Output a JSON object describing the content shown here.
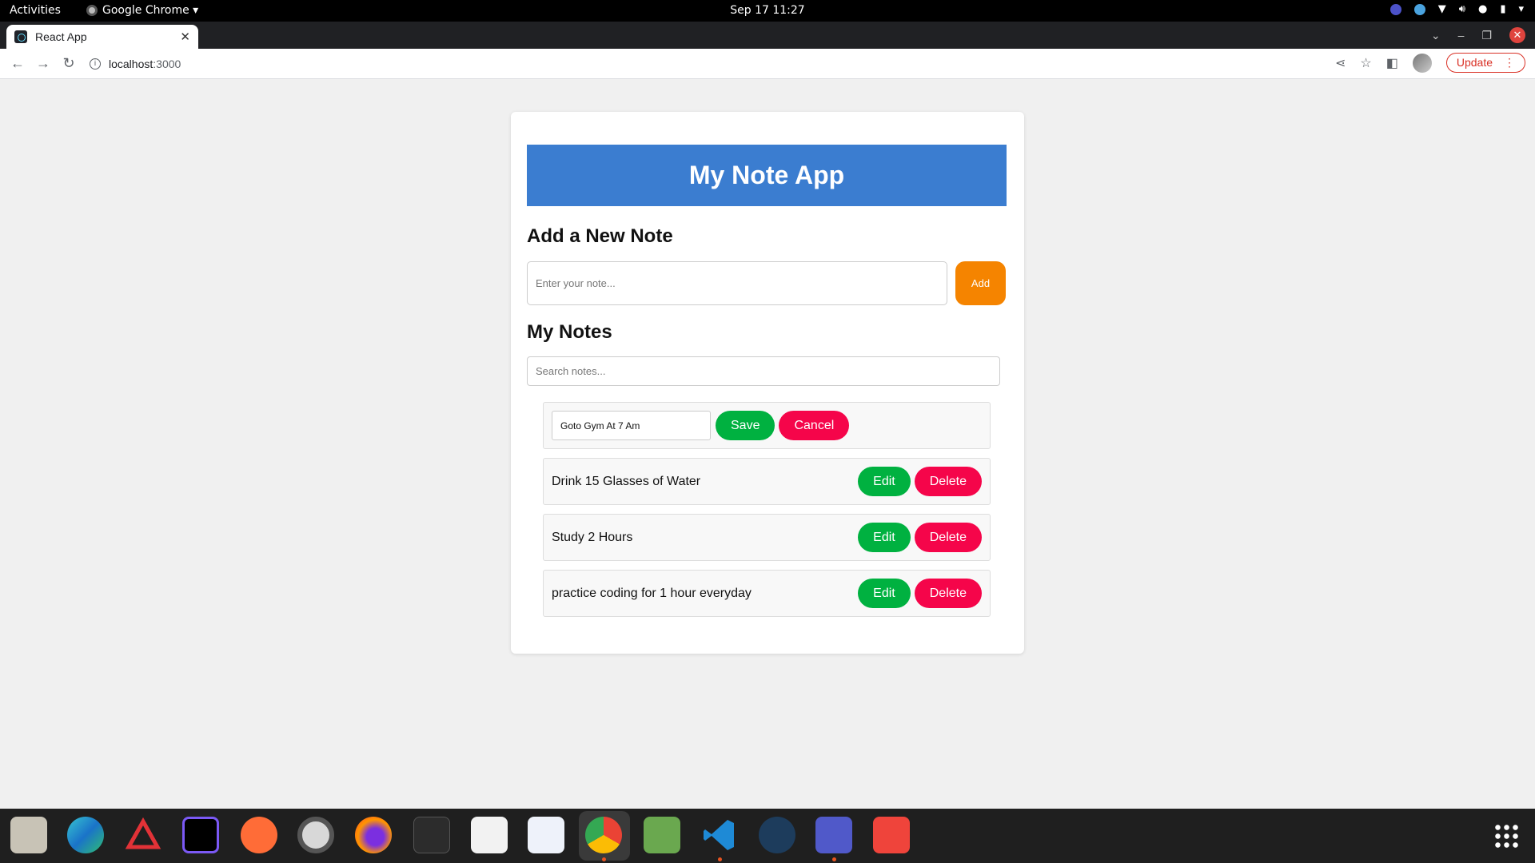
{
  "system": {
    "activities": "Activities",
    "app_menu": "Google Chrome ▾",
    "clock": "Sep 17  11:27"
  },
  "browser": {
    "tab_title": "React App",
    "tab_close": "✕",
    "new_tab": "+",
    "url_host": "localhost",
    "url_port": ":3000",
    "update_label": "Update",
    "update_menu": "⋮"
  },
  "app": {
    "banner_title": "My Note App",
    "add_section_title": "Add a New Note",
    "note_input_placeholder": "Enter your note...",
    "add_button": "Add",
    "notes_section_title": "My Notes",
    "search_placeholder": "Search notes...",
    "editing_note": {
      "value": "Goto Gym At 7 Am",
      "save_label": "Save",
      "cancel_label": "Cancel"
    },
    "notes": [
      {
        "text": "Drink 15 Glasses of Water",
        "edit_label": "Edit",
        "delete_label": "Delete"
      },
      {
        "text": "Study 2 Hours",
        "edit_label": "Edit",
        "delete_label": "Delete"
      },
      {
        "text": "practice coding for 1 hour everyday",
        "edit_label": "Edit",
        "delete_label": "Delete"
      }
    ]
  },
  "colors": {
    "banner": "#3b7dd0",
    "add_button": "#f58400",
    "green_button": "#00b140",
    "red_button": "#f5054a"
  },
  "dock": {
    "apps": [
      "files-icon",
      "edge-beta-icon",
      "angular-icon",
      "intellij-icon",
      "postman-icon",
      "settings-icon",
      "firefox-icon",
      "terminal-icon",
      "document-viewer-icon",
      "text-editor-icon",
      "chrome-icon",
      "spreadsheet-icon",
      "vscode-icon",
      "password-manager-icon",
      "teams-icon",
      "anydesk-icon"
    ]
  }
}
